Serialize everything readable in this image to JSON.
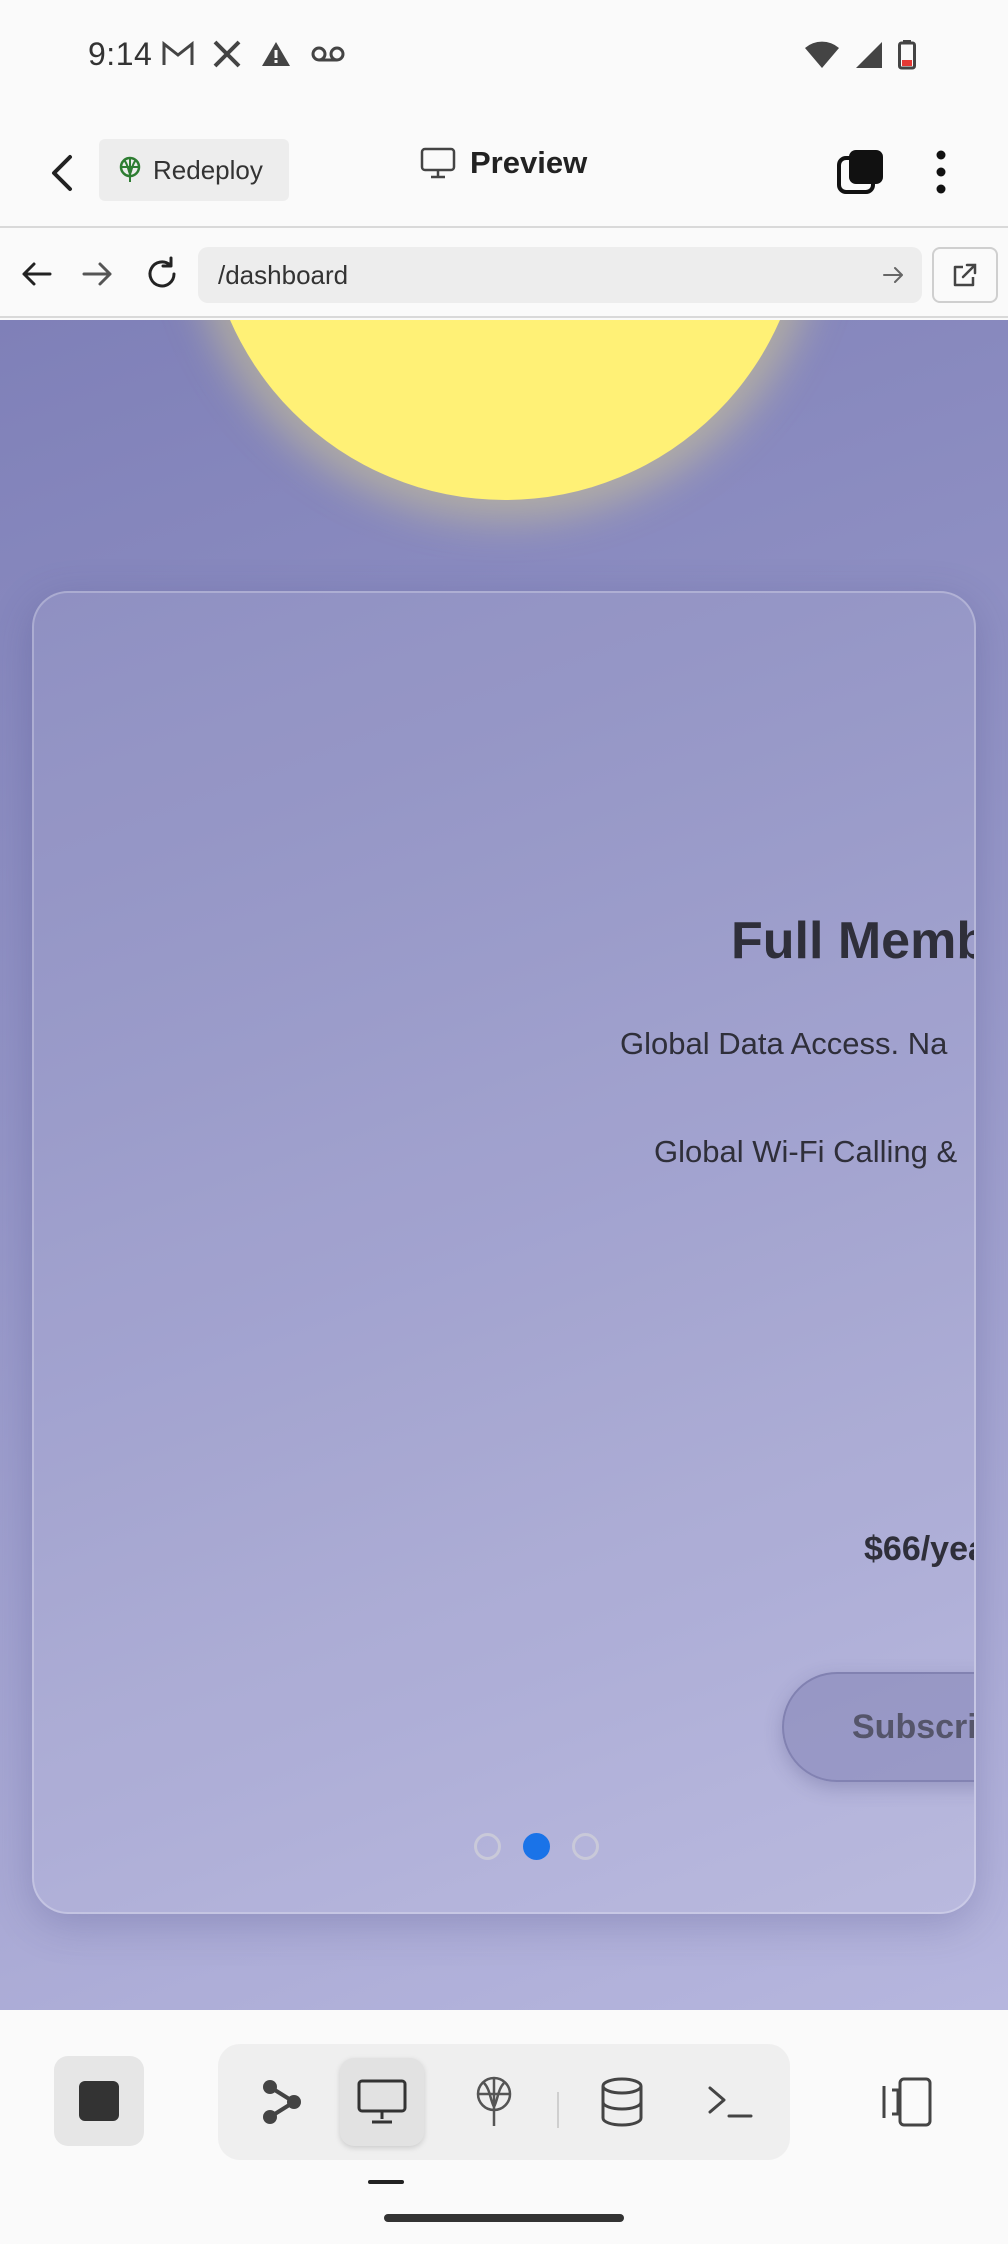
{
  "status_bar": {
    "time": "9:14"
  },
  "header": {
    "redeploy_label": "Redeploy",
    "title": "Preview"
  },
  "browser": {
    "url": "/dashboard"
  },
  "card": {
    "title": "Full Memb",
    "feature_1": "Global Data Access. Na",
    "feature_2": "Global Wi-Fi Calling &",
    "price": "$66/yea",
    "button_label": "Subscri",
    "carousel": {
      "count": 3,
      "active_index": 1
    }
  },
  "colors": {
    "active_dot": "#1a73e8",
    "sun": "#fff176",
    "background_start": "#7f80b8",
    "background_end": "#b6b6de"
  },
  "toolbar": {
    "icons": [
      "stop-icon",
      "workflow-icon",
      "desktop-icon",
      "deploy-icon",
      "database-icon",
      "terminal-icon",
      "split-view-icon"
    ],
    "active_tool": "desktop-icon"
  }
}
